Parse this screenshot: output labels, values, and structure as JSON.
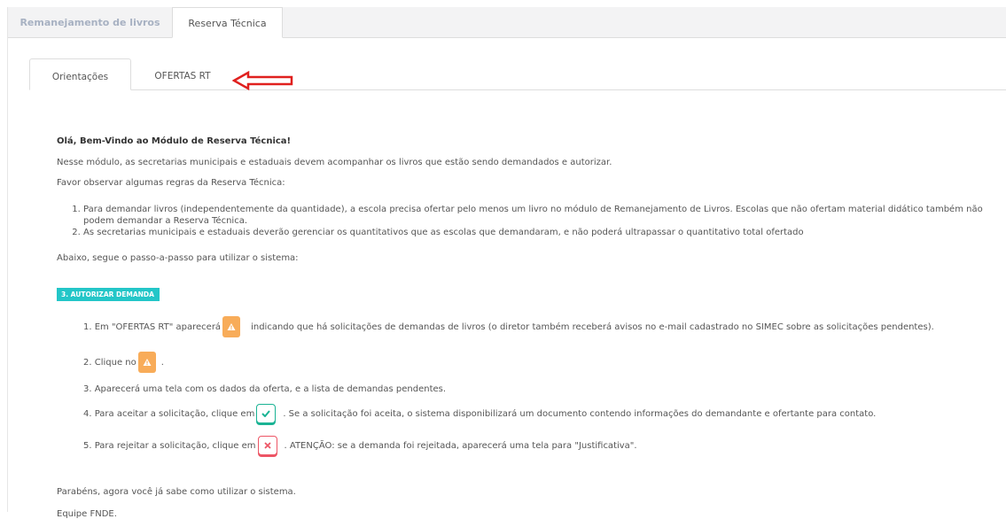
{
  "top_tabs": [
    "Remanejamento de livros",
    "Reserva Técnica"
  ],
  "inner_tabs": [
    "Orientações",
    "OFERTAS RT"
  ],
  "content": {
    "welcome": "Olá, Bem-Vindo ao Módulo de Reserva Técnica!",
    "intro": "Nesse módulo, as secretarias municipais e estaduais devem acompanhar os livros que estão sendo demandados e autorizar.",
    "rules_heading": "Favor observar algumas regras da Reserva Técnica:",
    "rules": [
      "Para demandar livros (independentemente da quantidade), a escola precisa ofertar pelo menos um livro no módulo de Remanejamento de Livros. Escolas que não ofertam material didático também não podem demandar a Reserva Técnica.",
      "As secretarias municipais e estaduais deverão gerenciar os quantitativos que as escolas que demandaram, e não poderá ultrapassar o quantitativo total ofertado"
    ],
    "steps_intro": "Abaixo, segue o passo-a-passo para utilizar o sistema:",
    "badge": "3. AUTORIZAR DEMANDA",
    "steps": {
      "s1_a": "1. Em \"OFERTAS RT\" aparecerá",
      "s1_b": "indicando que há solicitações de demandas de livros (o diretor também receberá avisos no e-mail cadastrado no SIMEC sobre as solicitações pendentes).",
      "s2_a": "2. Clique no",
      "s2_b": ".",
      "s3": "3. Aparecerá uma tela com os dados da oferta, e a lista de demandas pendentes.",
      "s4_a": "4. Para aceitar a solicitação, clique em",
      "s4_b": ". Se a solicitação foi aceita, o sistema disponibilizará um documento contendo informações do demandante e ofertante para contato.",
      "s5_a": "5. Para rejeitar a solicitação, clique em",
      "s5_b": ". ATENÇÃO: se a demanda foi rejeitada, aparecerá uma tela para \"Justificativa\"."
    },
    "congrats": "Parabéns, agora você já sabe como utilizar o sistema.",
    "signature": "Equipe FNDE."
  },
  "icons": {
    "warning": "warning-icon",
    "accept": "check-icon",
    "reject": "close-icon",
    "arrow": "red-arrow-annotation"
  },
  "colors": {
    "badge": "#23c6c8",
    "warning": "#f8ac59",
    "accept": "#1ab394",
    "reject": "#ed5565",
    "arrow": "#e0201e"
  }
}
